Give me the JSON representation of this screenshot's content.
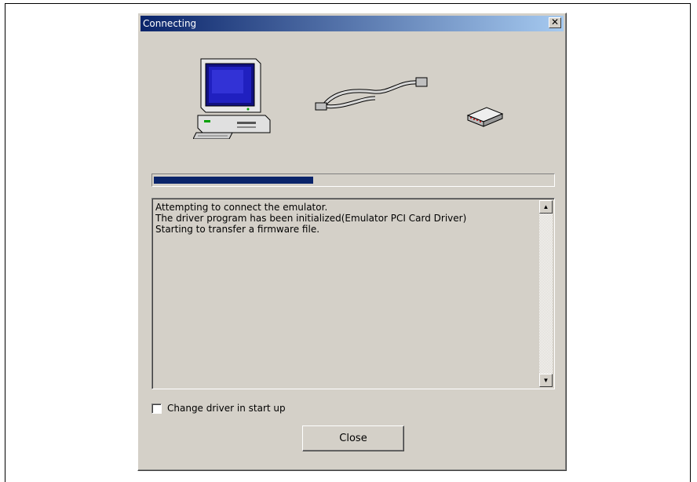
{
  "window": {
    "title": "Connecting",
    "close_glyph": "✕"
  },
  "icons": {
    "computer": "computer-icon",
    "cable": "cable-icon",
    "emulator": "emulator-device-icon"
  },
  "progress": {
    "fraction": 0.4
  },
  "log": {
    "lines": [
      "Attempting to connect the emulator.",
      "The driver program has been initialized(Emulator PCI Card Driver)",
      "Starting to transfer a firmware file."
    ]
  },
  "options": {
    "change_driver_label": "Change driver in start up",
    "change_driver_checked": false
  },
  "buttons": {
    "close_label": "Close"
  },
  "colors": {
    "titlebar_start": "#0a246a",
    "titlebar_end": "#a6caf0",
    "progress_fill": "#0a246a",
    "face": "#d4d0c8"
  }
}
